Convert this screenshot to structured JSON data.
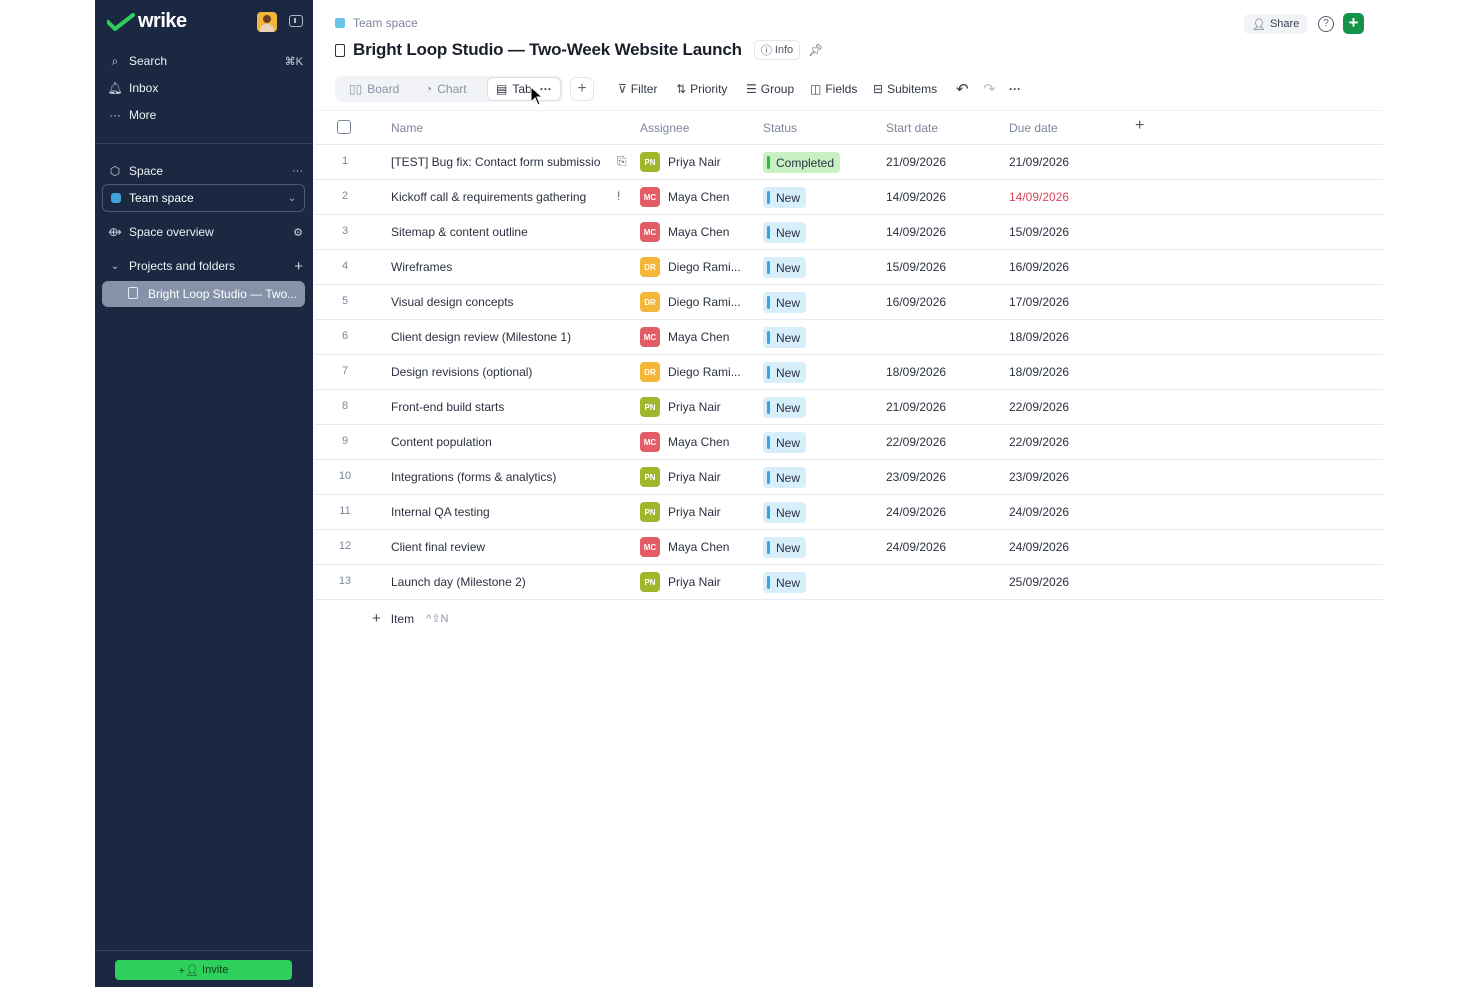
{
  "app": {
    "name": "wrike"
  },
  "sidebar": {
    "nav": [
      {
        "label": "Search",
        "shortcut": "⌘K",
        "icon": "search-icon"
      },
      {
        "label": "Inbox",
        "icon": "bell-icon"
      },
      {
        "label": "More",
        "icon": "more-icon"
      }
    ],
    "space_label": "Space",
    "space_select": "Team space",
    "space_overview": "Space overview",
    "projects_label": "Projects and folders",
    "project_item": "Bright Loop Studio — Two...",
    "invite": "Invite"
  },
  "header": {
    "breadcrumb": "Team space",
    "title": "Bright Loop Studio — Two-Week Website Launch",
    "info": "Info",
    "share": "Share"
  },
  "toolbar": {
    "views": [
      "Board",
      "Chart",
      "Tab"
    ],
    "tools": [
      "Filter",
      "Priority",
      "Group",
      "Fields",
      "Subitems"
    ]
  },
  "table": {
    "columns": [
      "Name",
      "Assignee",
      "Status",
      "Start date",
      "Due date"
    ],
    "rows": [
      {
        "n": "1",
        "name": "[TEST] Bug fix: Contact form submissio",
        "attach": true,
        "assignee": "Priya Nair",
        "initials": "PN",
        "status": "Completed",
        "start": "21/09/2026",
        "due": "21/09/2026",
        "overdue": false
      },
      {
        "n": "2",
        "name": "Kickoff call & requirements gathering",
        "flag": "!",
        "assignee": "Maya Chen",
        "initials": "MC",
        "status": "New",
        "start": "14/09/2026",
        "due": "14/09/2026",
        "overdue": true
      },
      {
        "n": "3",
        "name": "Sitemap & content outline",
        "assignee": "Maya Chen",
        "initials": "MC",
        "status": "New",
        "start": "14/09/2026",
        "due": "15/09/2026"
      },
      {
        "n": "4",
        "name": "Wireframes",
        "assignee": "Diego Rami...",
        "initials": "DR",
        "status": "New",
        "start": "15/09/2026",
        "due": "16/09/2026"
      },
      {
        "n": "5",
        "name": "Visual design concepts",
        "assignee": "Diego Rami...",
        "initials": "DR",
        "status": "New",
        "start": "16/09/2026",
        "due": "17/09/2026"
      },
      {
        "n": "6",
        "name": "Client design review (Milestone 1)",
        "assignee": "Maya Chen",
        "initials": "MC",
        "status": "New",
        "start": "",
        "due": "18/09/2026"
      },
      {
        "n": "7",
        "name": "Design revisions (optional)",
        "assignee": "Diego Rami...",
        "initials": "DR",
        "status": "New",
        "start": "18/09/2026",
        "due": "18/09/2026"
      },
      {
        "n": "8",
        "name": "Front-end build starts",
        "assignee": "Priya Nair",
        "initials": "PN",
        "status": "New",
        "start": "21/09/2026",
        "due": "22/09/2026"
      },
      {
        "n": "9",
        "name": "Content population",
        "assignee": "Maya Chen",
        "initials": "MC",
        "status": "New",
        "start": "22/09/2026",
        "due": "22/09/2026"
      },
      {
        "n": "10",
        "name": "Integrations (forms & analytics)",
        "assignee": "Priya Nair",
        "initials": "PN",
        "status": "New",
        "start": "23/09/2026",
        "due": "23/09/2026"
      },
      {
        "n": "11",
        "name": "Internal QA testing",
        "assignee": "Priya Nair",
        "initials": "PN",
        "status": "New",
        "start": "24/09/2026",
        "due": "24/09/2026"
      },
      {
        "n": "12",
        "name": "Client final review",
        "assignee": "Maya Chen",
        "initials": "MC",
        "status": "New",
        "start": "24/09/2026",
        "due": "24/09/2026"
      },
      {
        "n": "13",
        "name": "Launch day (Milestone 2)",
        "assignee": "Priya Nair",
        "initials": "PN",
        "status": "New",
        "start": "",
        "due": "25/09/2026"
      }
    ],
    "add_item": "Item",
    "add_item_shortcut": "^⇧N"
  },
  "colors": {
    "sidebar_bg": "#1b2842",
    "PN": "#a2b62c",
    "MC": "#e35d67",
    "DR": "#f4b73a",
    "completed_bg": "#c9f0c3",
    "completed_bar": "#35b44a",
    "new_bg": "#d6effa",
    "new_bar": "#3aa2dc",
    "overdue": "#d9485a",
    "accent": "#16934b"
  }
}
